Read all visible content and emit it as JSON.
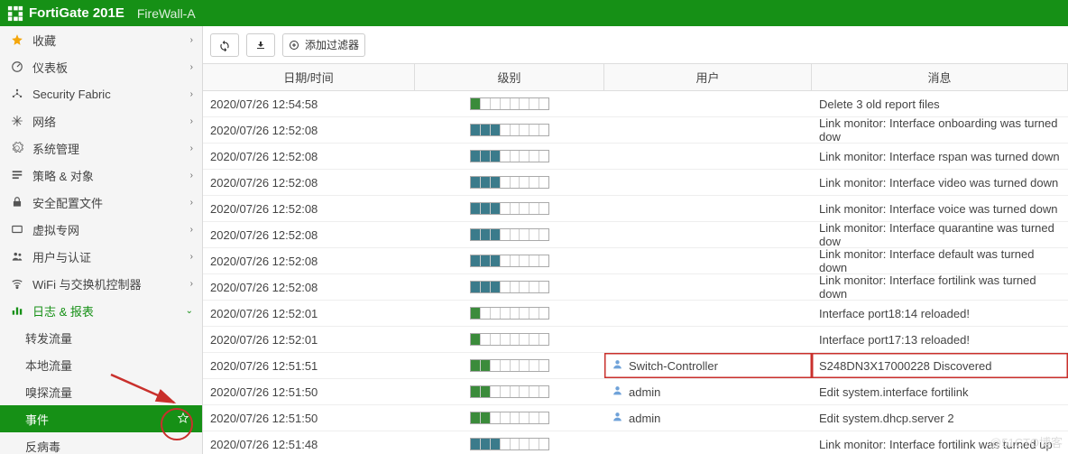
{
  "header": {
    "product": "FortiGate 201E",
    "hostname": "FireWall-A"
  },
  "sidebar": {
    "items": [
      {
        "label": "收藏",
        "icon": "star",
        "class": "fav"
      },
      {
        "label": "仪表板",
        "icon": "dashboard"
      },
      {
        "label": "Security Fabric",
        "icon": "fabric"
      },
      {
        "label": "网络",
        "icon": "network"
      },
      {
        "label": "系统管理",
        "icon": "gear"
      },
      {
        "label": "策略 & 对象",
        "icon": "policy"
      },
      {
        "label": "安全配置文件",
        "icon": "lock"
      },
      {
        "label": "虚拟专网",
        "icon": "vpn"
      },
      {
        "label": "用户与认证",
        "icon": "users"
      },
      {
        "label": "WiFi 与交换机控制器",
        "icon": "wifi"
      },
      {
        "label": "日志 & 报表",
        "icon": "bars",
        "class": "active-top",
        "chev": "v"
      }
    ],
    "sub": [
      {
        "label": "转发流量"
      },
      {
        "label": "本地流量"
      },
      {
        "label": "嗅探流量"
      },
      {
        "label": "事件",
        "active": true
      },
      {
        "label": "反病毒"
      }
    ]
  },
  "toolbar": {
    "add_filter": "添加过滤器"
  },
  "columns": {
    "date": "日期/时间",
    "level": "级别",
    "user": "用户",
    "msg": "消息"
  },
  "rows": [
    {
      "date": "2020/07/26 12:54:58",
      "fill": 1,
      "color": "f",
      "user": "",
      "msg": "Delete 3 old report files"
    },
    {
      "date": "2020/07/26 12:52:08",
      "fill": 3,
      "color": "f2",
      "user": "",
      "msg": "Link monitor: Interface onboarding was turned dow"
    },
    {
      "date": "2020/07/26 12:52:08",
      "fill": 3,
      "color": "f2",
      "user": "",
      "msg": "Link monitor: Interface rspan was turned down"
    },
    {
      "date": "2020/07/26 12:52:08",
      "fill": 3,
      "color": "f2",
      "user": "",
      "msg": "Link monitor: Interface video was turned down"
    },
    {
      "date": "2020/07/26 12:52:08",
      "fill": 3,
      "color": "f2",
      "user": "",
      "msg": "Link monitor: Interface voice was turned down"
    },
    {
      "date": "2020/07/26 12:52:08",
      "fill": 3,
      "color": "f2",
      "user": "",
      "msg": "Link monitor: Interface quarantine was turned dow"
    },
    {
      "date": "2020/07/26 12:52:08",
      "fill": 3,
      "color": "f2",
      "user": "",
      "msg": "Link monitor: Interface default was turned down"
    },
    {
      "date": "2020/07/26 12:52:08",
      "fill": 3,
      "color": "f2",
      "user": "",
      "msg": "Link monitor: Interface fortilink was turned down"
    },
    {
      "date": "2020/07/26 12:52:01",
      "fill": 1,
      "color": "f",
      "user": "",
      "msg": "Interface port18:14 reloaded!"
    },
    {
      "date": "2020/07/26 12:52:01",
      "fill": 1,
      "color": "f",
      "user": "",
      "msg": "Interface port17:13 reloaded!"
    },
    {
      "date": "2020/07/26 12:51:51",
      "fill": 2,
      "color": "f",
      "user": "Switch-Controller",
      "msg": "S248DN3X17000228 Discovered",
      "highlight": true
    },
    {
      "date": "2020/07/26 12:51:50",
      "fill": 2,
      "color": "f",
      "user": "admin",
      "msg": "Edit system.interface fortilink"
    },
    {
      "date": "2020/07/26 12:51:50",
      "fill": 2,
      "color": "f",
      "user": "admin",
      "msg": "Edit system.dhcp.server 2"
    },
    {
      "date": "2020/07/26 12:51:48",
      "fill": 3,
      "color": "f2",
      "user": "",
      "msg": "Link monitor: Interface fortilink was turned up"
    }
  ],
  "watermark": "@51CTO博客"
}
